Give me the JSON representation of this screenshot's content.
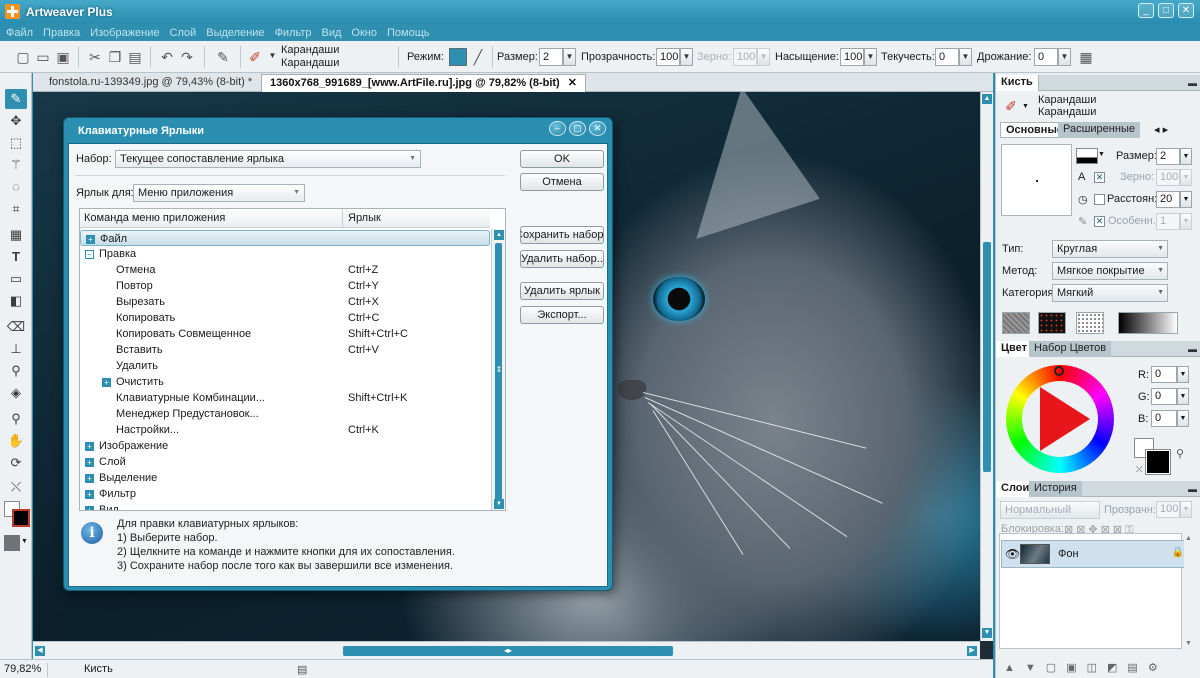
{
  "window": {
    "title": "Artweaver Plus",
    "controls": [
      "_",
      "□",
      "✕"
    ]
  },
  "menu": [
    "Файл",
    "Правка",
    "Изображение",
    "Слой",
    "Выделение",
    "Фильтр",
    "Вид",
    "Окно",
    "Помощь"
  ],
  "options": {
    "brush_category": "Карандаши",
    "brush_name": "Карандаши",
    "mode_label": "Режим:",
    "size_label": "Размер:",
    "size_value": "2",
    "opacity_label": "Прозрачность:",
    "opacity_value": "100",
    "grain_label": "Зерно:",
    "grain_value": "100",
    "saturation_label": "Насыщение:",
    "saturation_value": "100",
    "flow_label": "Текучесть:",
    "flow_value": "0",
    "jitter_label": "Дрожание:",
    "jitter_value": "0"
  },
  "tabs": [
    {
      "label": "fonstola.ru-139349.jpg @ 79,43% (8-bit) *"
    },
    {
      "label": "1360x768_991689_[www.ArtFile.ru].jpg @ 79,82% (8-bit)",
      "close": "✕"
    }
  ],
  "status": {
    "zoom": "79,82%",
    "tool": "Кисть"
  },
  "brush_panel": {
    "title": "Кисть",
    "category": "Карандаши",
    "name": "Карандаши",
    "tab_basic": "Основные",
    "tab_advanced": "Расширенные",
    "size_label": "Размер:",
    "size_value": "2",
    "grain_label": "Зерно:",
    "grain_value": "100",
    "spacing_label": "Расстоян:",
    "spacing_value": "20",
    "special_label": "Особенн.:",
    "special_value": "1",
    "type_label": "Тип:",
    "type_value": "Круглая",
    "method_label": "Метод:",
    "method_value": "Мягкое покрытие",
    "category_label": "Категория:",
    "category_value": "Мягкий"
  },
  "color_panel": {
    "tab_color": "Цвет",
    "tab_swatches": "Набор Цветов",
    "r_label": "R:",
    "r_value": "0",
    "g_label": "G:",
    "g_value": "0",
    "b_label": "B:",
    "b_value": "0",
    "foreground": "#000000",
    "background": "#ffffff"
  },
  "layers_panel": {
    "tab_layers": "Слои",
    "tab_history": "История",
    "blend_mode": "Нормальный",
    "opacity_label": "Прозрачн:",
    "opacity_value": "100",
    "lock_label": "Блокировка:",
    "layer_name": "Фон"
  },
  "dialog": {
    "title": "Клавиатурные Ярлыки",
    "set_label": "Набор:",
    "set_value": "Текущее сопоставление ярлыка",
    "shortcut_for_label": "Ярлык для:",
    "shortcut_for_value": "Меню приложения",
    "col_command": "Команда меню приложения",
    "col_shortcut": "Ярлык",
    "buttons": {
      "ok": "OK",
      "cancel": "Отмена",
      "save_set": "Сохранить набор...",
      "delete_set": "Удалить набор...",
      "delete_shortcut": "Удалить ярлык",
      "export": "Экспорт..."
    },
    "rows": [
      {
        "name": "Файл",
        "key": "",
        "level": 0,
        "expander": "+"
      },
      {
        "name": "Правка",
        "key": "",
        "level": 0,
        "expander": "−"
      },
      {
        "name": "Отмена",
        "key": "Ctrl+Z",
        "level": 1,
        "expander": ""
      },
      {
        "name": "Повтор",
        "key": "Ctrl+Y",
        "level": 1,
        "expander": ""
      },
      {
        "name": "Вырезать",
        "key": "Ctrl+X",
        "level": 1,
        "expander": ""
      },
      {
        "name": "Копировать",
        "key": "Ctrl+C",
        "level": 1,
        "expander": ""
      },
      {
        "name": "Копировать Совмещенное",
        "key": "Shift+Ctrl+C",
        "level": 1,
        "expander": ""
      },
      {
        "name": "Вставить",
        "key": "Ctrl+V",
        "level": 1,
        "expander": ""
      },
      {
        "name": "Удалить",
        "key": "",
        "level": 1,
        "expander": ""
      },
      {
        "name": "Очистить",
        "key": "",
        "level": 1,
        "expander": "+"
      },
      {
        "name": "Клавиатурные Комбинации...",
        "key": "Shift+Ctrl+K",
        "level": 1,
        "expander": ""
      },
      {
        "name": "Менеджер Предустановок...",
        "key": "",
        "level": 1,
        "expander": ""
      },
      {
        "name": "Настройки...",
        "key": "Ctrl+K",
        "level": 1,
        "expander": ""
      },
      {
        "name": "Изображение",
        "key": "",
        "level": 0,
        "expander": "+"
      },
      {
        "name": "Слой",
        "key": "",
        "level": 0,
        "expander": "+"
      },
      {
        "name": "Выделение",
        "key": "",
        "level": 0,
        "expander": "+"
      },
      {
        "name": "Фильтр",
        "key": "",
        "level": 0,
        "expander": "+"
      },
      {
        "name": "Вид",
        "key": "",
        "level": 0,
        "expander": "+"
      }
    ],
    "info": {
      "line1": "Для правки клавиатурных ярлыков:",
      "line2": "1) Выберите набор.",
      "line3": "2) Щелкните на команде и нажмите кнопки для их сопоставления.",
      "line4": "3) Сохраните набор после того как вы завершили все изменения."
    }
  },
  "accent_color": "#2e8fb1"
}
